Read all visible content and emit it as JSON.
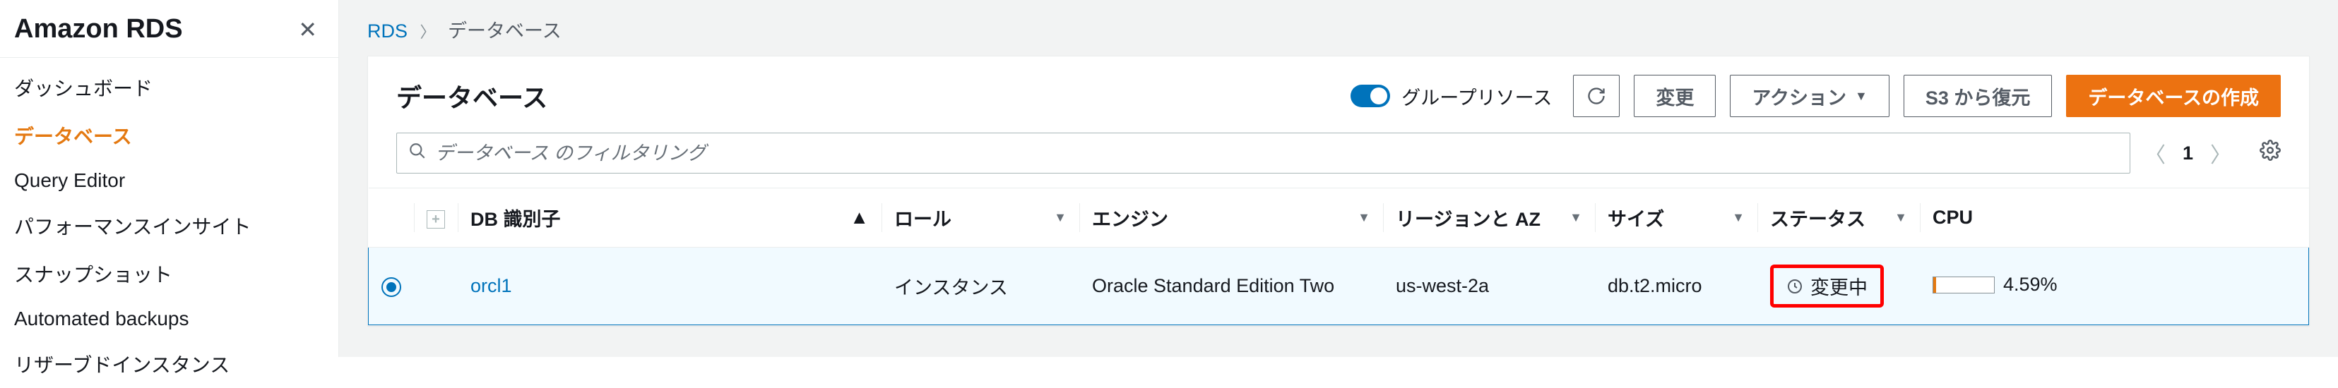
{
  "sidebar": {
    "title": "Amazon RDS",
    "items": [
      {
        "label": "ダッシュボード",
        "active": false
      },
      {
        "label": "データベース",
        "active": true
      },
      {
        "label": "Query Editor",
        "active": false
      },
      {
        "label": "パフォーマンスインサイト",
        "active": false
      },
      {
        "label": "スナップショット",
        "active": false
      },
      {
        "label": "Automated backups",
        "active": false
      },
      {
        "label": "リザーブドインスタンス",
        "active": false
      }
    ]
  },
  "breadcrumb": {
    "root": "RDS",
    "current": "データベース"
  },
  "header": {
    "title": "データベース",
    "group_toggle_label": "グループリソース",
    "modify_label": "変更",
    "actions_label": "アクション",
    "restore_label": "S3 から復元",
    "create_label": "データベースの作成"
  },
  "filter": {
    "placeholder": "データベース のフィルタリング",
    "page": "1"
  },
  "columns": {
    "db_identifier": "DB 識別子",
    "role": "ロール",
    "engine": "エンジン",
    "region_az": "リージョンと AZ",
    "size": "サイズ",
    "status": "ステータス",
    "cpu": "CPU"
  },
  "rows": [
    {
      "id": "orcl1",
      "role": "インスタンス",
      "engine": "Oracle Standard Edition Two",
      "region_az": "us-west-2a",
      "size": "db.t2.micro",
      "status": "変更中",
      "cpu_pct": "4.59%",
      "cpu_width": "4.59%"
    }
  ]
}
